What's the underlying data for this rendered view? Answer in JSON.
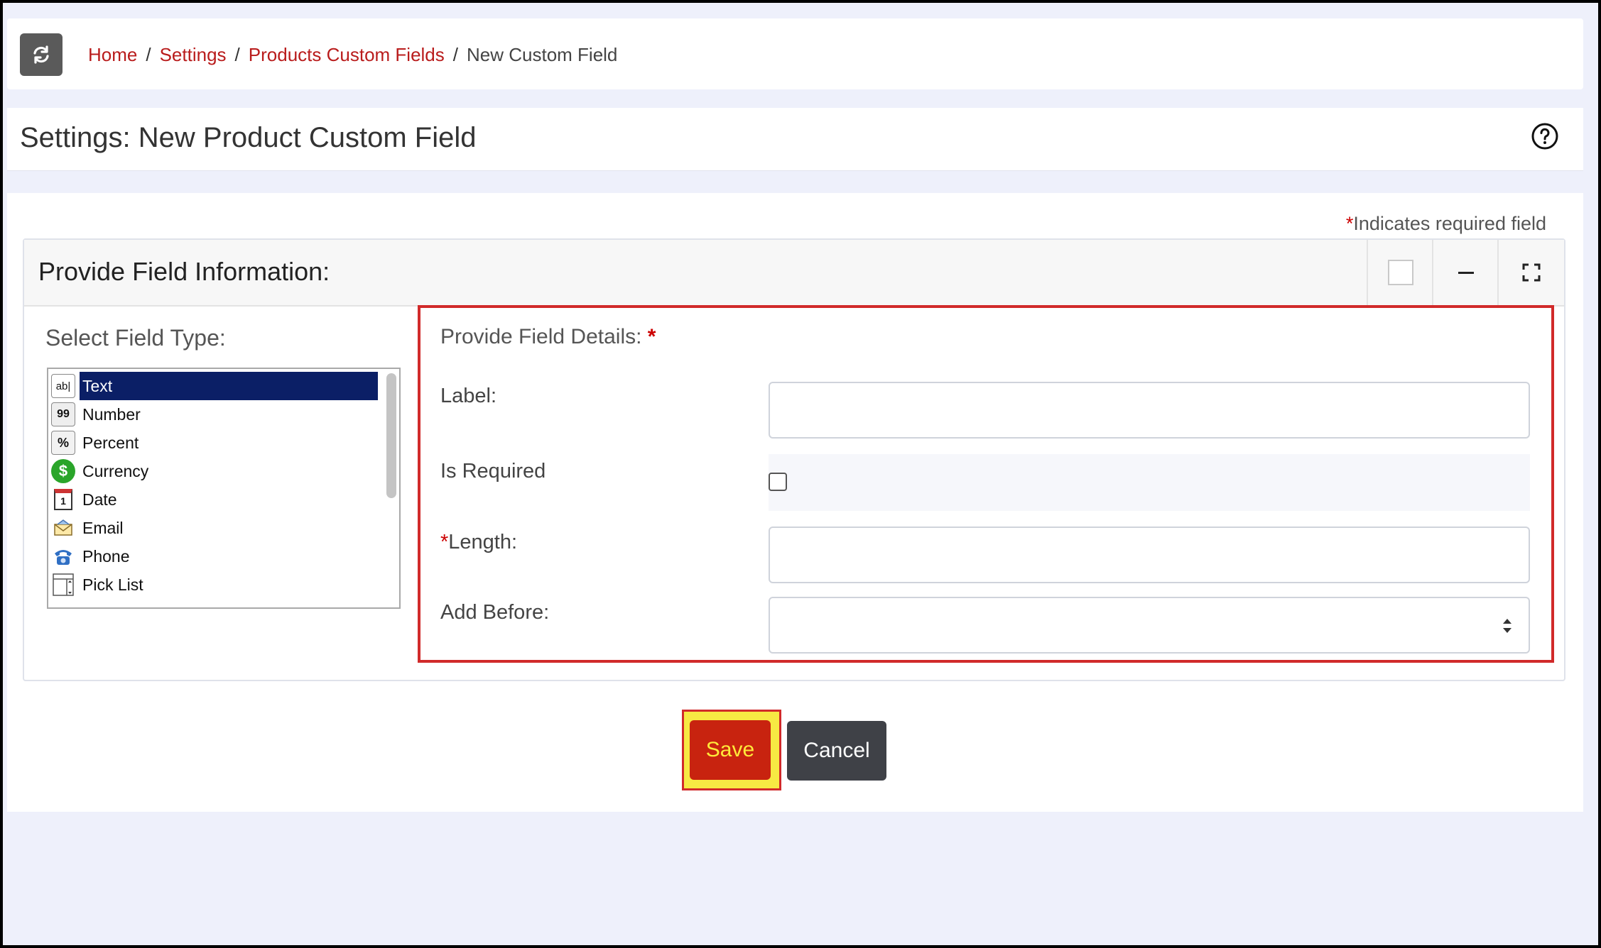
{
  "breadcrumb": {
    "items": [
      "Home",
      "Settings",
      "Products Custom Fields"
    ],
    "separator": "/",
    "current": "New Custom Field"
  },
  "header": {
    "title": "Settings: New Product Custom Field"
  },
  "required_note": {
    "star": "*",
    "text": "Indicates required field"
  },
  "card": {
    "title": "Provide Field Information:"
  },
  "field_type": {
    "title": "Select Field Type:",
    "items": [
      {
        "label": "Text",
        "icon": "text-icon",
        "selected": true
      },
      {
        "label": "Number",
        "icon": "number-icon",
        "selected": false
      },
      {
        "label": "Percent",
        "icon": "percent-icon",
        "selected": false
      },
      {
        "label": "Currency",
        "icon": "currency-icon",
        "selected": false
      },
      {
        "label": "Date",
        "icon": "calendar-icon",
        "selected": false
      },
      {
        "label": "Email",
        "icon": "email-icon",
        "selected": false
      },
      {
        "label": "Phone",
        "icon": "phone-icon",
        "selected": false
      },
      {
        "label": "Pick List",
        "icon": "picklist-icon",
        "selected": false
      }
    ]
  },
  "details": {
    "title": "Provide Field Details:",
    "title_star": "*",
    "label_field": {
      "label": "Label:",
      "value": ""
    },
    "is_required": {
      "label": "Is Required",
      "checked": false
    },
    "length_field": {
      "star": "*",
      "label": "Length:",
      "value": ""
    },
    "add_before": {
      "label": "Add Before:",
      "value": ""
    }
  },
  "actions": {
    "save_label": "Save",
    "cancel_label": "Cancel"
  },
  "colors": {
    "link": "#b91c1c",
    "save_bg": "#c8230f",
    "save_text": "#ffe93a",
    "highlight": "#f7e943",
    "selected_item": "#0b1f66"
  }
}
